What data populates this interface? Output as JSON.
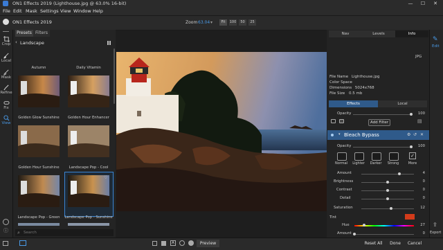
{
  "window": {
    "title": "ON1 Effects 2019 (Lighthouse.jpg @ 63.0% 16-bit)"
  },
  "menu": [
    "File",
    "Edit",
    "Mask",
    "Settings",
    "View",
    "Window",
    "Help"
  ],
  "toolbar": {
    "app_name": "ON1 Effects 2019",
    "zoom_label": "Zoom",
    "zoom_value": "63.04",
    "zoom_buttons": [
      "Fit",
      "100",
      "50",
      "25"
    ]
  },
  "left_tools": [
    "Crop",
    "Local",
    "Mask",
    "Refine",
    "Fix",
    "View"
  ],
  "browser": {
    "tabs": [
      "Presets",
      "Filters"
    ],
    "category": "Landscape",
    "thumbnails": [
      {
        "caption": "Autumn"
      },
      {
        "caption": "Daily Vitamin"
      },
      {
        "caption": "Golden Glow Sunshine"
      },
      {
        "caption": "Golden Hour Enhancer"
      },
      {
        "caption": "Golden Hour Sunshine"
      },
      {
        "caption": "Landscape Pop - Cool"
      },
      {
        "caption": "Landscape Pop - Green"
      },
      {
        "caption": "Landscape Pop - Sunshine"
      }
    ],
    "search_placeholder": "Search"
  },
  "right_panel": {
    "tabs": [
      "Nav",
      "Levels",
      "Info"
    ],
    "file_type": "JPG",
    "info": {
      "file_name_label": "File Name",
      "file_name": "Lighthouse.jpg",
      "color_space_label": "Color Space",
      "color_space": "",
      "dimensions_label": "Dimensions",
      "dimensions": "5024x768",
      "file_size_label": "File Size",
      "file_size": "0.5 mb"
    },
    "effects_tabs": [
      "Effects",
      "Local"
    ],
    "opacity_label": "Opacity",
    "opacity_value": "100",
    "opacity_fraction": 1.0,
    "add_filter_label": "Add Filter",
    "filter": {
      "name": "Bleach Bypass",
      "opacity_label": "Opacity",
      "opacity_value": "100",
      "opacity_fraction": 1.0,
      "presets": [
        "Normal",
        "Lighter",
        "Darker",
        "Strong",
        "More"
      ],
      "sliders": [
        {
          "label": "Amount",
          "value": "4",
          "fraction": 0.72
        },
        {
          "label": "Brightness",
          "value": "0",
          "fraction": 0.5
        },
        {
          "label": "Contrast",
          "value": "0",
          "fraction": 0.5
        },
        {
          "label": "Detail",
          "value": "0",
          "fraction": 0.5
        },
        {
          "label": "Saturation",
          "value": "12",
          "fraction": 0.56
        }
      ],
      "tint_label": "Tint",
      "tint_color": "#d23b1a",
      "hue_label": "Hue",
      "hue_value": "27",
      "hue_fraction": 0.16,
      "amount_label": "Amount",
      "amount_value": "0",
      "amount_fraction": 0.0
    }
  },
  "right_bar": {
    "edit_label": "Edit",
    "export_label": "Export"
  },
  "bottom": {
    "preview_label": "Preview",
    "reset_all_label": "Reset All",
    "done_label": "Done",
    "cancel_label": "Cancel"
  },
  "colors": {
    "accent": "#3a86d6",
    "panel": "#232323",
    "tint": "#d23b1a"
  }
}
